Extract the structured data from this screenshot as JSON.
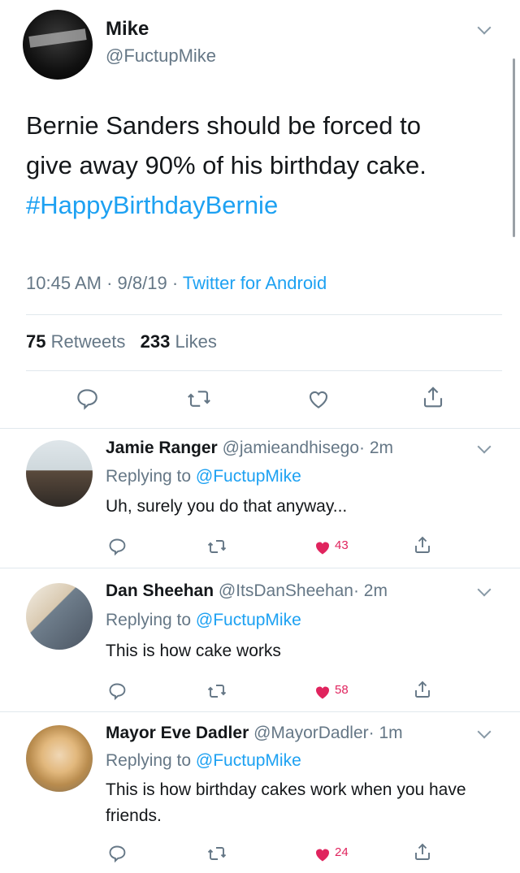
{
  "tweet": {
    "name": "Mike",
    "handle": "@FuctupMike",
    "text_line1": "Bernie Sanders should be forced to",
    "text_line2": "give away 90% of his birthday cake.",
    "hashtag": "#HappyBirthdayBernie",
    "time": "10:45 AM",
    "date": "9/8/19",
    "dot": "·",
    "source": "Twitter for Android",
    "retweets_count": "75",
    "retweets_label": "Retweets",
    "likes_count": "233",
    "likes_label": "Likes"
  },
  "replying_label": "Replying to",
  "replies": [
    {
      "name": "Jamie Ranger",
      "handle": "@jamieandhisego",
      "time": "· 2m",
      "replying_to": "@FuctupMike",
      "text": "Uh, surely you do that anyway...",
      "likes": "43"
    },
    {
      "name": "Dan Sheehan",
      "handle": "@ItsDanSheehan",
      "time": "· 2m",
      "replying_to": "@FuctupMike",
      "text": "This is how cake works",
      "likes": "58"
    },
    {
      "name": "Mayor Eve Dadler",
      "handle": "@MayorDadler",
      "time": "· 1m",
      "replying_to": "@FuctupMike",
      "text": "This is how birthday cakes work when you have friends.",
      "likes": "24"
    }
  ],
  "icons": [
    "reply-icon",
    "retweet-icon",
    "like-icon",
    "share-icon",
    "chevron-down-icon"
  ],
  "colors": {
    "link": "#1da1f2",
    "muted": "#657786",
    "like": "#e0245e"
  }
}
